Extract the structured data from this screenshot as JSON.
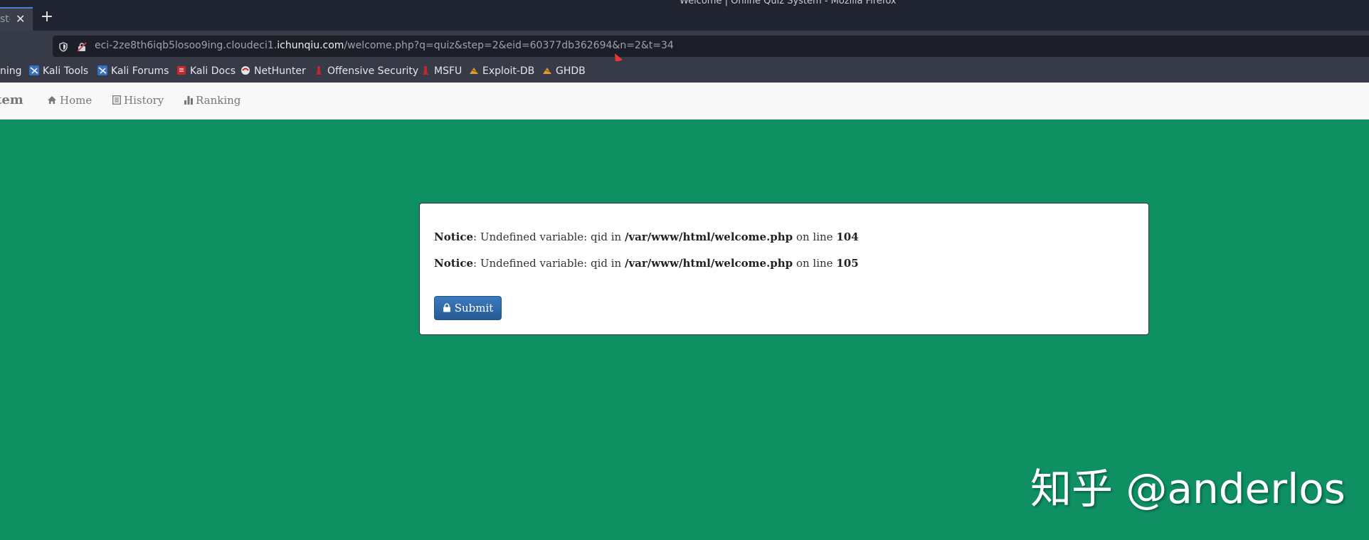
{
  "window": {
    "title": "Welcome | Online Quiz System - Mozilla Firefox"
  },
  "tab": {
    "label": "ste",
    "close_icon": "close-icon"
  },
  "urlbar": {
    "prefix": "eci-2ze8th6iqb5losoo9ing.cloudeci1.",
    "domain": "ichunqiu.com",
    "path": "/welcome.php?q=quiz&step=2&eid=60377db362694&n=2&t=34"
  },
  "bookmarks": [
    {
      "label": "ning",
      "icon": "none"
    },
    {
      "label": "Kali Tools",
      "icon": "kali-icon"
    },
    {
      "label": "Kali Forums",
      "icon": "kali-icon"
    },
    {
      "label": "Kali Docs",
      "icon": "docs-icon"
    },
    {
      "label": "NetHunter",
      "icon": "nethunter-icon"
    },
    {
      "label": "Offensive Security",
      "icon": "offsec-icon"
    },
    {
      "label": "MSFU",
      "icon": "offsec-icon"
    },
    {
      "label": "Exploit-DB",
      "icon": "exploitdb-icon"
    },
    {
      "label": "GHDB",
      "icon": "exploitdb-icon"
    }
  ],
  "site_nav": {
    "brand": "tem",
    "items": [
      {
        "label": "Home",
        "icon": "home-icon"
      },
      {
        "label": "History",
        "icon": "list-icon"
      },
      {
        "label": "Ranking",
        "icon": "bar-chart-icon"
      }
    ]
  },
  "notices": [
    {
      "label": "Notice",
      "message": ": Undefined variable: qid in ",
      "file": "/var/www/html/welcome.php",
      "mid": " on line ",
      "line": "104"
    },
    {
      "label": "Notice",
      "message": ": Undefined variable: qid in ",
      "file": "/var/www/html/welcome.php",
      "mid": " on line ",
      "line": "105"
    }
  ],
  "submit": {
    "label": "Submit",
    "icon": "lock-icon"
  },
  "watermark": "知乎 @anderlos",
  "colors": {
    "page_background": "#0e9063",
    "button": "#2f6aa8",
    "arrow": "#e53935"
  }
}
